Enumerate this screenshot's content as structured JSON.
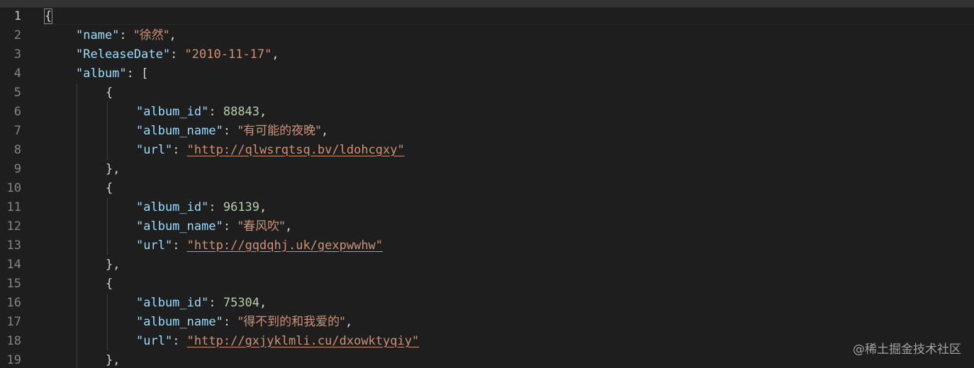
{
  "editor": {
    "line_numbers": [
      "1",
      "2",
      "3",
      "4",
      "5",
      "6",
      "7",
      "8",
      "9",
      "10",
      "11",
      "12",
      "13",
      "14",
      "15",
      "16",
      "17",
      "18",
      "19"
    ],
    "tokens": {
      "open_brace": "{",
      "close_brace": "}",
      "open_bracket": "[",
      "colon": ": ",
      "comma": ",",
      "close_obj_comma": "},",
      "key_name": "\"name\"",
      "val_name": "\"徐然\"",
      "key_release": "\"ReleaseDate\"",
      "val_release": "\"2010-11-17\"",
      "key_album": "\"album\"",
      "key_album_id": "\"album_id\"",
      "key_album_name": "\"album_name\"",
      "key_url": "\"url\"",
      "id1": "88843",
      "name1": "\"有可能的夜晚\"",
      "url1_q1": "\"",
      "url1": "http://qlwsrqtsq.bv/ldohcgxy",
      "url1_q2": "\"",
      "id2": "96139",
      "name2": "\"春风吹\"",
      "url2": "http://gqdqhj.uk/gexpwwhw",
      "id3": "75304",
      "name3": "\"得不到的和我爱的\"",
      "url3": "http://gxjyklmli.cu/dxowktyqiy",
      "quote": "\""
    }
  },
  "watermark": "@稀土掘金技术社区"
}
